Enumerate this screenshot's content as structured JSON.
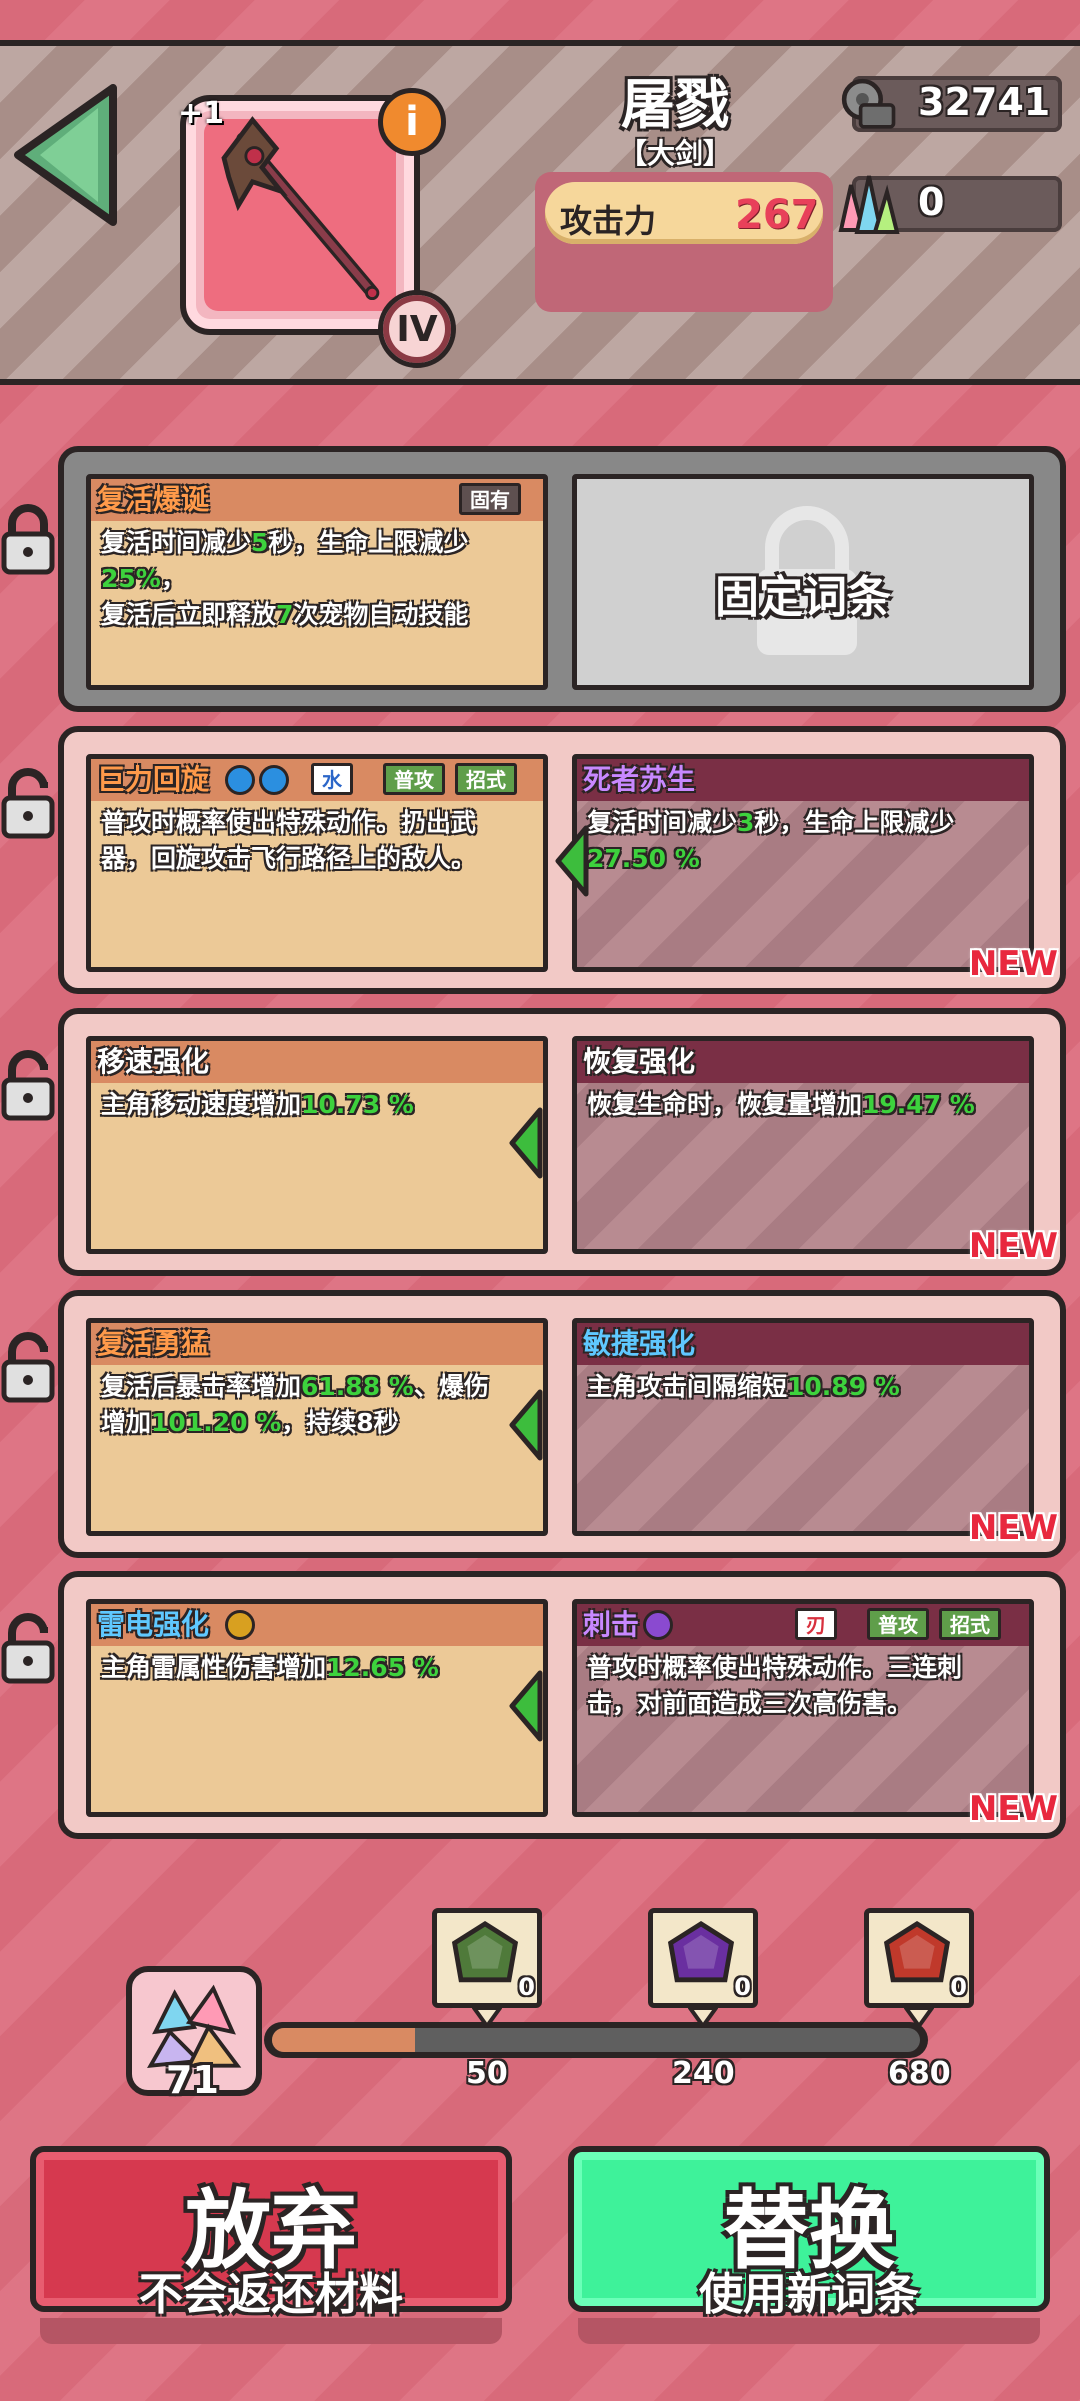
{
  "header": {
    "plus": "+1",
    "info": "i",
    "rank": "IV",
    "weapon_name": "屠戮",
    "weapon_type": "【大剑】",
    "atk_label": "攻击力",
    "atk_value": "267",
    "gold": "32741",
    "crystals": "0"
  },
  "rows": [
    {
      "left": {
        "title": "复活爆诞",
        "tag": "固有",
        "desc": [
          [
            {
              "t": "复活时间减少"
            },
            {
              "t": "5",
              "g": true
            },
            {
              "t": "秒，生命上限减少"
            }
          ],
          [
            {
              "t": "25%",
              "g": true
            },
            {
              "t": "，"
            }
          ],
          [
            {
              "t": "复活后立即释放"
            },
            {
              "t": "7",
              "g": true
            },
            {
              "t": "次宠物自动技能"
            }
          ]
        ]
      },
      "fixed_label": "固定词条"
    },
    {
      "left": {
        "title": "巨力回旋",
        "tags": [
          "水",
          "普攻",
          "招式"
        ],
        "desc": [
          [
            {
              "t": "普攻时概率使出特殊动作。扔出武"
            }
          ],
          [
            {
              "t": "器，回旋攻击飞行路径上的敌人。"
            }
          ]
        ]
      },
      "right": {
        "title": "死者苏生",
        "desc": [
          [
            {
              "t": "复活时间减少"
            },
            {
              "t": "3",
              "g": true
            },
            {
              "t": "秒，生命上限减少"
            }
          ],
          [
            {
              "t": "27.50 %",
              "g": true
            }
          ]
        ],
        "new": "NEW"
      }
    },
    {
      "left": {
        "title": "移速强化",
        "desc": [
          [
            {
              "t": "主角移动速度增加"
            },
            {
              "t": "10.73 %",
              "g": true
            }
          ]
        ]
      },
      "right": {
        "title": "恢复强化",
        "desc": [
          [
            {
              "t": "恢复生命时，恢复量增加"
            },
            {
              "t": "19.47 %",
              "g": true
            }
          ]
        ],
        "new": "NEW"
      }
    },
    {
      "left": {
        "title": "复活勇猛",
        "desc": [
          [
            {
              "t": "复活后暴击率增加"
            },
            {
              "t": "61.88 %",
              "g": true
            },
            {
              "t": "、爆伤"
            }
          ],
          [
            {
              "t": "增加"
            },
            {
              "t": "101.20 %",
              "g": true
            },
            {
              "t": "，持续8秒"
            }
          ]
        ]
      },
      "right": {
        "title": "敏捷强化",
        "desc": [
          [
            {
              "t": "主角攻击间隔缩短"
            },
            {
              "t": "10.89 %",
              "g": true
            }
          ]
        ],
        "new": "NEW"
      }
    },
    {
      "left": {
        "title": "雷电强化",
        "desc": [
          [
            {
              "t": "主角雷属性伤害增加"
            },
            {
              "t": "12.65 %",
              "g": true
            }
          ]
        ]
      },
      "right": {
        "title": "刺击",
        "tags": [
          "刃",
          "普攻",
          "招式"
        ],
        "desc": [
          [
            {
              "t": "普攻时概率使出特殊动作。三连刺"
            }
          ],
          [
            {
              "t": "击，对前面造成三次高伤害。"
            }
          ]
        ],
        "new": "NEW"
      }
    }
  ],
  "materials": {
    "owned": "71",
    "progress": 0.22,
    "gems": [
      {
        "count": "0",
        "threshold": "50",
        "color": "#4f7a3a"
      },
      {
        "count": "0",
        "threshold": "240",
        "color": "#6a2fa0"
      },
      {
        "count": "0",
        "threshold": "680",
        "color": "#c0392b"
      }
    ]
  },
  "buttons": {
    "abandon": "放弃",
    "abandon_sub": "不会返还材料",
    "replace": "替换",
    "replace_sub": "使用新词条"
  }
}
